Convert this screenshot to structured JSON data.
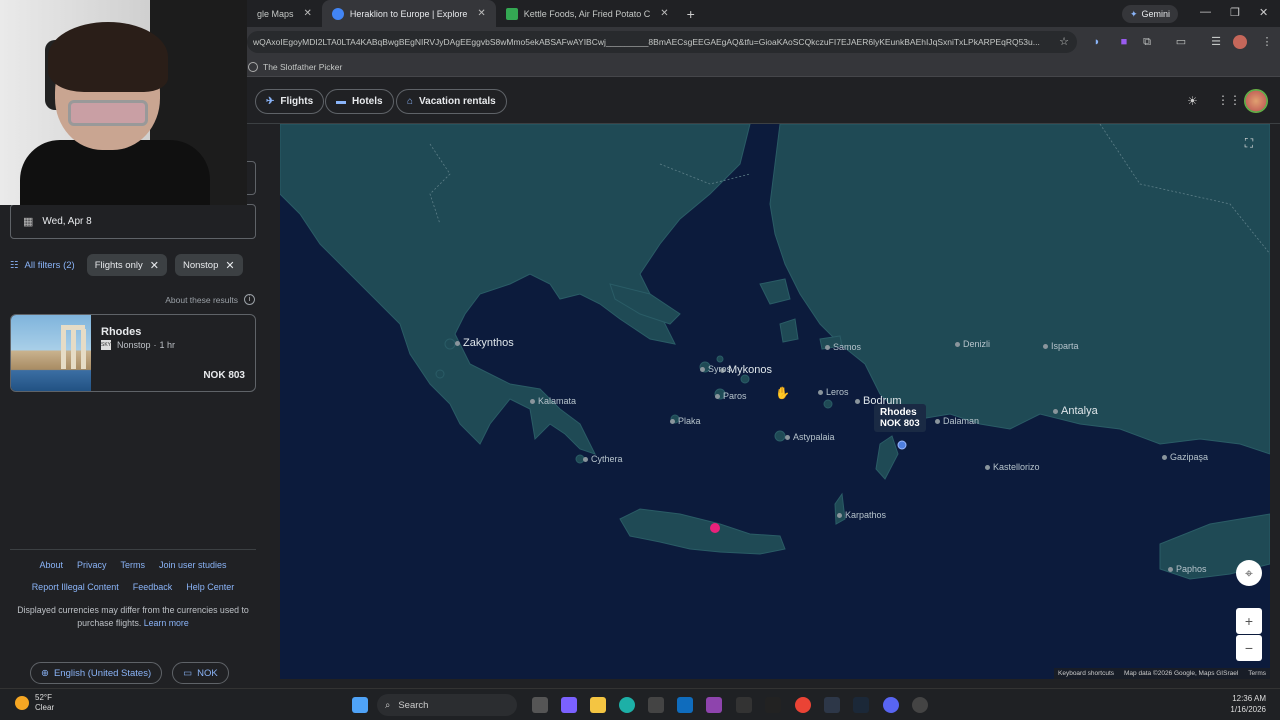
{
  "browser": {
    "tabs": [
      {
        "label": "gle Maps",
        "active": false
      },
      {
        "label": "Heraklion to Europe | Explore",
        "active": true
      },
      {
        "label": "Kettle Foods, Air Fried Potato C",
        "active": false
      }
    ],
    "gemini_label": "Gemini",
    "url": "wQAxoIEgoyMDI2LTA0LTA4KABqBwgBEgNIRVJyDAgEEggvbS8wMmo5ekABSAFwAYIBCwj_________8BmAECsgEEGAEgAQ&tfu=GioaKAoSCQkczuFI7EJAER6lyKEunkBAEhIJqSxniTxLPkARPEqRQ53u...",
    "bookmark": "The Slotfather Picker"
  },
  "nav": {
    "flights": "Flights",
    "hotels": "Hotels",
    "vacation_rentals": "Vacation rentals"
  },
  "left": {
    "date": "Wed, Apr 8",
    "all_filters": "All filters (2)",
    "chip_flights_only": "Flights only",
    "chip_nonstop": "Nonstop",
    "about_results": "About these results",
    "result": {
      "city": "Rhodes",
      "stops": "Nonstop",
      "duration": "1 hr",
      "price": "NOK 803",
      "airline_logo_text": "SKY"
    },
    "footer": {
      "about": "About",
      "privacy": "Privacy",
      "terms": "Terms",
      "join": "Join user studies",
      "report": "Report Illegal Content",
      "feedback": "Feedback",
      "help": "Help Center",
      "note": "Displayed currencies may differ from the currencies used to purchase flights.",
      "learn_more": "Learn more",
      "language": "English (United States)",
      "currency": "NOK"
    }
  },
  "map": {
    "labels": [
      {
        "name": "Zakynthos",
        "big": true
      },
      {
        "name": "Mykonos",
        "big": true
      },
      {
        "name": "Syros",
        "big": false
      },
      {
        "name": "Paros",
        "big": false
      },
      {
        "name": "Plaka",
        "big": false
      },
      {
        "name": "Kalamata",
        "big": false
      },
      {
        "name": "Cythera",
        "big": false
      },
      {
        "name": "Astypalaia",
        "big": false
      },
      {
        "name": "Leros",
        "big": false
      },
      {
        "name": "Samos",
        "big": false
      },
      {
        "name": "Bodrum",
        "big": true
      },
      {
        "name": "Dalaman",
        "big": false
      },
      {
        "name": "Antalya",
        "big": true
      },
      {
        "name": "Denizli",
        "big": false
      },
      {
        "name": "Isparta",
        "big": false
      },
      {
        "name": "Kastellorizo",
        "big": false
      },
      {
        "name": "Karpathos",
        "big": false
      },
      {
        "name": "Gazipaşa",
        "big": false
      },
      {
        "name": "Paphos",
        "big": false
      }
    ],
    "callout_city": "Rhodes",
    "callout_price": "NOK 803",
    "attribution": [
      "Keyboard shortcuts",
      "Map data ©2026 Google, Maps GISrael",
      "Terms"
    ],
    "colors": {
      "sea": "#0c1b3c",
      "land": "#1f4a55",
      "origin_pin": "#e8217b"
    }
  },
  "taskbar": {
    "temp": "52°F",
    "condition": "Clear",
    "search": "Search",
    "time": "12:36 AM",
    "date": "1/16/2026"
  }
}
